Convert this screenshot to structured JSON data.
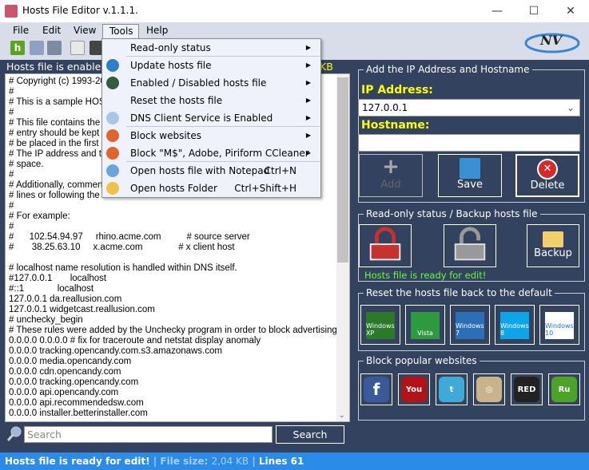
{
  "window": {
    "title": "Hosts File Editor v.1.1.1.",
    "minimize": "—",
    "maximize": "☐",
    "close": "✕"
  },
  "menubar": [
    "File",
    "Edit",
    "View",
    "Tools",
    "Help"
  ],
  "logo_text": "NV",
  "tools_menu": [
    {
      "label": "Read-only status",
      "icon": "none",
      "submenu": true
    },
    {
      "label": "Update hosts file",
      "icon": "globe-icon",
      "submenu": true
    },
    {
      "label": "Enabled / Disabled hosts file",
      "icon": "hosts-h-icon",
      "submenu": true
    },
    {
      "label": "Reset the hosts file",
      "icon": "none",
      "submenu": true
    },
    {
      "label": "DNS Client Service is Enabled",
      "icon": "gear-icon",
      "submenu": true
    },
    {
      "label": "Block websites",
      "icon": "block-icon",
      "submenu": true
    },
    {
      "label": "Block \"M$\", Adobe, Piriform CCleaner",
      "icon": "block-icon",
      "submenu": true
    },
    {
      "label": "Open hosts file with Notepad",
      "icon": "notepad-icon",
      "shortcut": "Ctrl+N"
    },
    {
      "label": "Open hosts Folder",
      "icon": "folder-icon",
      "shortcut": "Ctrl+Shift+H"
    }
  ],
  "editor": {
    "header": "Hosts file is enabled.",
    "header_suffix": "KB",
    "lines": [
      "# Copyright (c) 1993-20",
      "#",
      "# This is a sample HOS",
      "#",
      "# This file contains the m",
      "# entry should be kept o",
      "# be placed in the first c",
      "# The IP address and th",
      "# space.",
      "#",
      "# Additionally, comment",
      "# lines or following the r",
      "#",
      "# For example:",
      "#",
      "#      102.54.94.97     rhino.acme.com          # source server",
      "#       38.25.63.10     x.acme.com              # x client host",
      "",
      "# localhost name resolution is handled within DNS itself.",
      "#127.0.0.1       localhost",
      "#::1             localhost",
      "127.0.0.1 da.reallusion.com",
      "127.0.0.1 widgetcast.reallusion.com",
      "# unchecky_begin",
      "# These rules were added by the Unchecky program in order to block advertising",
      "0.0.0.0 0.0.0.0 # fix for traceroute and netstat display anomaly",
      "0.0.0.0 tracking.opencandy.com.s3.amazonaws.com",
      "0.0.0.0 media.opencandy.com",
      "0.0.0.0 cdn.opencandy.com",
      "0.0.0.0 tracking.opencandy.com",
      "0.0.0.0 api.opencandy.com",
      "0.0.0.0 api.recommendedsw.com",
      "0.0.0.0 installer.betterinstaller.com"
    ]
  },
  "search": {
    "placeholder": "Search",
    "button": "Search"
  },
  "status": {
    "message": "Hosts file is ready for edit!",
    "sep": "|",
    "filesize_label": "File size:",
    "filesize": "2,04 KB",
    "lines": "Lines 61"
  },
  "add_group": {
    "legend": "Add the IP Address  and Hostname",
    "ip_label": "IP Address:",
    "ip_value": "127.0.0.1",
    "host_label": "Hostname:",
    "host_value": "",
    "add": "Add",
    "save": "Save",
    "delete": "Delete"
  },
  "readonly_group": {
    "legend": "Read-only status / Backup hosts file",
    "backup": "Backup",
    "status": "Hosts file is ready for edit!"
  },
  "reset_group": {
    "legend": "Reset the hosts file back to the default",
    "items": [
      "Windows XP",
      "Vista",
      "Windows 7",
      "Windows 8",
      "Windows 10"
    ]
  },
  "block_group": {
    "legend": "Block popular websites",
    "items": [
      "Facebook",
      "YouTube",
      "Twitter",
      "Instagram",
      "RedTube",
      "Ru"
    ]
  },
  "colors": {
    "panel": "#33425f",
    "status_bar": "#2b8be9",
    "label_yellow": "#ffff00",
    "ready_green": "#66ff33"
  }
}
